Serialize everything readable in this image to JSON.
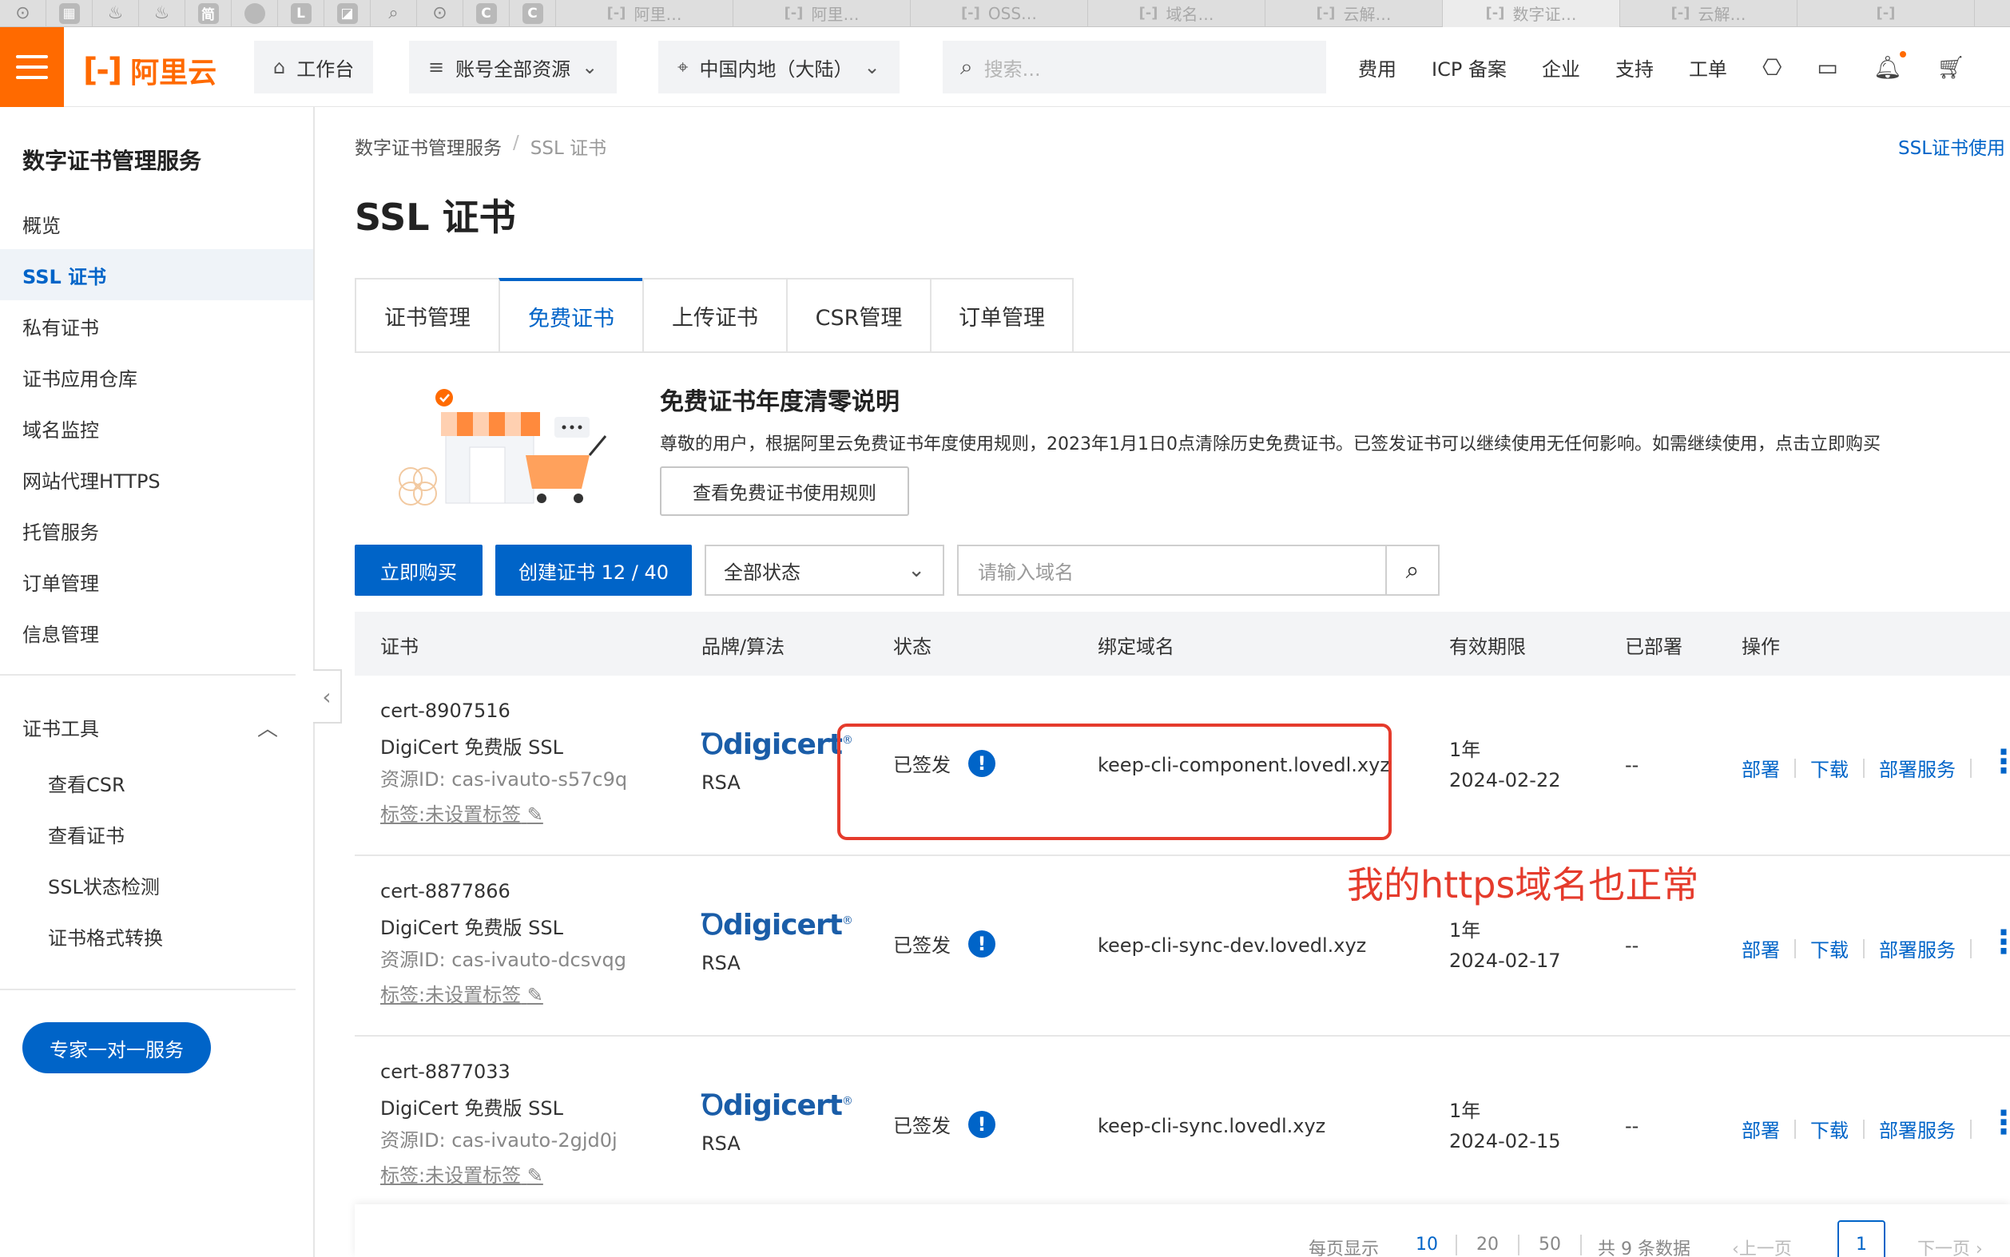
{
  "browser_tabs": {
    "favicons": [
      "github-icon",
      "app-icon",
      "flame-icon",
      "flame-icon",
      "简",
      "circle",
      "L",
      "app-icon",
      "search-icon",
      "github-icon",
      "C",
      "C"
    ],
    "pages": [
      {
        "label": "阿里…",
        "active": false
      },
      {
        "label": "阿里…",
        "active": false
      },
      {
        "label": "OSS…",
        "active": false
      },
      {
        "label": "域名…",
        "active": false
      },
      {
        "label": "云解…",
        "active": false
      },
      {
        "label": "数字证…",
        "active": true
      },
      {
        "label": "云解…",
        "active": false
      },
      {
        "label": "",
        "active": false
      }
    ]
  },
  "header": {
    "logo_text": "阿里云",
    "workbench": "工作台",
    "account_resources": "账号全部资源",
    "region": "中国内地（大陆）",
    "search_placeholder": "搜索...",
    "links": [
      "费用",
      "ICP 备案",
      "企业",
      "支持",
      "工单"
    ],
    "icons": [
      "api-icon",
      "terminal-icon",
      "bell-icon",
      "cart-icon"
    ],
    "accent": "#ff6a00"
  },
  "sidebar": {
    "title": "数字证书管理服务",
    "items": [
      {
        "label": "概览",
        "active": false
      },
      {
        "label": "SSL 证书",
        "active": true
      },
      {
        "label": "私有证书",
        "active": false
      },
      {
        "label": "证书应用仓库",
        "active": false
      },
      {
        "label": "域名监控",
        "active": false
      },
      {
        "label": "网站代理HTTPS",
        "active": false
      },
      {
        "label": "托管服务",
        "active": false
      },
      {
        "label": "订单管理",
        "active": false
      },
      {
        "label": "信息管理",
        "active": false
      }
    ],
    "tools_group": "证书工具",
    "tools": [
      "查看CSR",
      "查看证书",
      "SSL状态检测",
      "证书格式转换"
    ],
    "expert_button": "专家一对一服务"
  },
  "main": {
    "breadcrumb": [
      "数字证书管理服务",
      "SSL 证书"
    ],
    "help_link": "SSL证书使用",
    "title": "SSL 证书",
    "tabs": [
      {
        "label": "证书管理",
        "active": false
      },
      {
        "label": "免费证书",
        "active": true
      },
      {
        "label": "上传证书",
        "active": false
      },
      {
        "label": "CSR管理",
        "active": false
      },
      {
        "label": "订单管理",
        "active": false
      }
    ],
    "notice": {
      "title": "免费证书年度清零说明",
      "text": "尊敬的用户，根据阿里云免费证书年度使用规则，2023年1月1日0点清除历史免费证书。已签发证书可以继续使用无任何影响。如需继续使用，点击立即购买",
      "button": "查看免费证书使用规则"
    },
    "toolbar": {
      "buy": "立即购买",
      "create": "创建证书 12 / 40",
      "status_select": "全部状态",
      "domain_placeholder": "请输入域名"
    },
    "table": {
      "headers": [
        "证书",
        "品牌/算法",
        "状态",
        "绑定域名",
        "有效期限",
        "已部署",
        "操作"
      ],
      "rows": [
        {
          "cert_id": "cert-8907516",
          "cert_name": "DigiCert 免费版 SSL",
          "resource_id": "资源ID: cas-ivauto-s57c9q",
          "tag": "标签:未设置标签",
          "brand": "digicert",
          "algorithm": "RSA",
          "status": "已签发",
          "domain": "keep-cli-component.lovedl.xyz",
          "validity_term": "1年",
          "validity_date": "2024-02-22",
          "deployed": "--",
          "actions": [
            "部署",
            "下载",
            "部署服务"
          ]
        },
        {
          "cert_id": "cert-8877866",
          "cert_name": "DigiCert 免费版 SSL",
          "resource_id": "资源ID: cas-ivauto-dcsvqg",
          "tag": "标签:未设置标签",
          "brand": "digicert",
          "algorithm": "RSA",
          "status": "已签发",
          "domain": "keep-cli-sync-dev.lovedl.xyz",
          "validity_term": "1年",
          "validity_date": "2024-02-17",
          "deployed": "--",
          "actions": [
            "部署",
            "下载",
            "部署服务"
          ]
        },
        {
          "cert_id": "cert-8877033",
          "cert_name": "DigiCert 免费版 SSL",
          "resource_id": "资源ID: cas-ivauto-2gjd0j",
          "tag": "标签:未设置标签",
          "brand": "digicert",
          "algorithm": "RSA",
          "status": "已签发",
          "domain": "keep-cli-sync.lovedl.xyz",
          "validity_term": "1年",
          "validity_date": "2024-02-15",
          "deployed": "--",
          "actions": [
            "部署",
            "下载",
            "部署服务"
          ]
        }
      ]
    },
    "annotation": "我的https域名也正常",
    "pagination": {
      "per_page_label": "每页显示",
      "sizes": [
        "10",
        "20",
        "50"
      ],
      "active_size": "10",
      "total": "共 9 条数据",
      "prev": "上一页",
      "current_page": "1",
      "next": "下一页"
    },
    "colors": {
      "primary": "#0064c8",
      "annotation": "#e53b2c"
    }
  }
}
